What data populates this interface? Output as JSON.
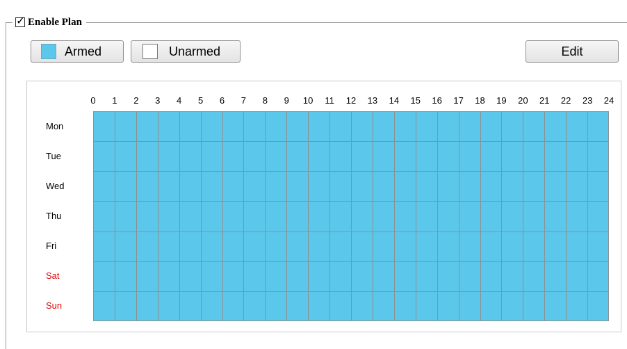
{
  "plan": {
    "enable_label": "Enable Plan",
    "enabled": true
  },
  "legend": {
    "armed_label": "Armed",
    "unarmed_label": "Unarmed",
    "armed_color": "#5bc7ea",
    "unarmed_color": "#ffffff"
  },
  "toolbar": {
    "edit_label": "Edit"
  },
  "schedule": {
    "hours": [
      "0",
      "1",
      "2",
      "3",
      "4",
      "5",
      "6",
      "7",
      "8",
      "9",
      "10",
      "11",
      "12",
      "13",
      "14",
      "15",
      "16",
      "17",
      "18",
      "19",
      "20",
      "21",
      "22",
      "23",
      "24"
    ],
    "days": [
      {
        "label": "Mon",
        "weekend": false
      },
      {
        "label": "Tue",
        "weekend": false
      },
      {
        "label": "Wed",
        "weekend": false
      },
      {
        "label": "Thu",
        "weekend": false
      },
      {
        "label": "Fri",
        "weekend": false
      },
      {
        "label": "Sat",
        "weekend": true
      },
      {
        "label": "Sun",
        "weekend": true
      }
    ],
    "armed_fraction": 1.0,
    "weekend_color": "#e30000",
    "grid_line_color": "#8f8f8f"
  }
}
